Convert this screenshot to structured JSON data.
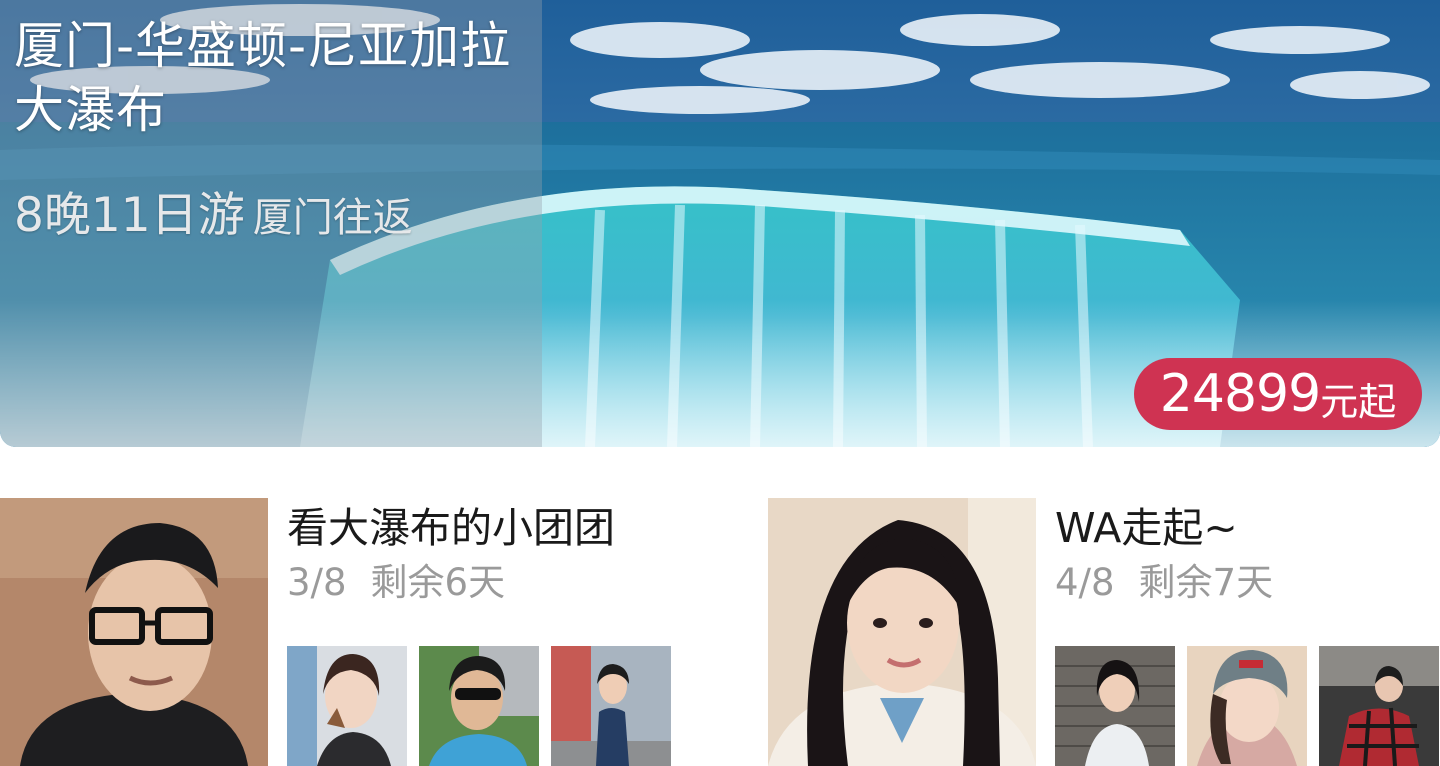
{
  "hero": {
    "title": "厦门-华盛顿-尼亚加拉大瀑布",
    "duration": "8晚11日游",
    "route": "厦门往返",
    "price_number": "24899",
    "price_unit": "元起",
    "background_icon": "waterfall-photo",
    "price_color": "#cf3352"
  },
  "groups": [
    {
      "name": "看大瀑布的小团团",
      "members_count": "3/8",
      "days_left": "剩余6天",
      "cover_icon": "avatar-photo-man-glasses",
      "member_icons": [
        "avatar-photo-girl-icecream",
        "avatar-photo-boy-sunglasses",
        "avatar-photo-girl-street"
      ]
    },
    {
      "name": "WA走起~",
      "members_count": "4/8",
      "days_left": "剩余7天",
      "cover_icon": "avatar-photo-girl-longhair",
      "member_icons": [
        "avatar-photo-girl-wall",
        "avatar-photo-girl-beanie",
        "avatar-photo-girl-plaid"
      ]
    }
  ]
}
